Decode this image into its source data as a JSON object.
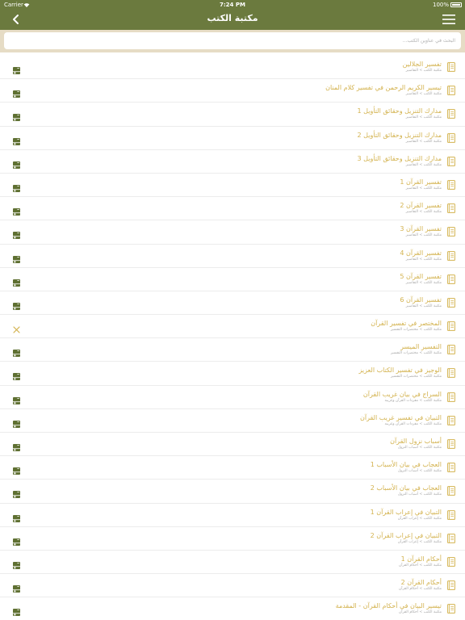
{
  "status_bar": {
    "carrier": "Carrier",
    "time": "7:24 PM",
    "battery": "100%"
  },
  "nav": {
    "title": "مكتبة الكتب"
  },
  "search": {
    "placeholder": "البحث في عناوين الكتب..."
  },
  "colors": {
    "header": "#6b7a3e",
    "search_bg": "#e6dcc5",
    "title_text": "#d3b24e",
    "subtitle_text": "#a8a8a8",
    "download_icon": "#5f7032",
    "book_icon": "#d3b24e"
  },
  "books": [
    {
      "title": "تفسير الجلالين",
      "subtitle": "مكتبة الكتب > التفاسير",
      "action": "download-icon"
    },
    {
      "title": "تيسير الكريم الرحمن في تفسير كلام المنان",
      "subtitle": "مكتبة الكتب > التفاسير",
      "action": "download-icon"
    },
    {
      "title": "مدارك التنزيل وحقائق التأويل 1",
      "subtitle": "مكتبة الكتب > التفاسير",
      "action": "download-icon"
    },
    {
      "title": "مدارك التنزيل وحقائق التأويل 2",
      "subtitle": "مكتبة الكتب > التفاسير",
      "action": "download-icon"
    },
    {
      "title": "مدارك التنزيل وحقائق التأويل 3",
      "subtitle": "مكتبة الكتب > التفاسير",
      "action": "download-icon"
    },
    {
      "title": "تفسير القرآن 1",
      "subtitle": "مكتبة الكتب > التفاسير",
      "action": "download-icon"
    },
    {
      "title": "تفسير القرآن 2",
      "subtitle": "مكتبة الكتب > التفاسير",
      "action": "download-icon"
    },
    {
      "title": "تفسير القرآن 3",
      "subtitle": "مكتبة الكتب > التفاسير",
      "action": "download-icon"
    },
    {
      "title": "تفسير القرآن 4",
      "subtitle": "مكتبة الكتب > التفاسير",
      "action": "download-icon"
    },
    {
      "title": "تفسير القرآن 5",
      "subtitle": "مكتبة الكتب > التفاسير",
      "action": "download-icon"
    },
    {
      "title": "تفسير القرآن 6",
      "subtitle": "مكتبة الكتب > التفاسير",
      "action": "download-icon"
    },
    {
      "title": "المختصر في تفسير القرآن",
      "subtitle": "مكتبة الكتب > مختصرات التفسير",
      "action": "close-icon"
    },
    {
      "title": "التفسير الميسر",
      "subtitle": "مكتبة الكتب > مختصرات التفسير",
      "action": "download-icon"
    },
    {
      "title": "الوجيز في تفسير الكتاب العزيز",
      "subtitle": "مكتبة الكتب > مختصرات التفسير",
      "action": "download-icon"
    },
    {
      "title": "السراج في بيان غريب القرآن",
      "subtitle": "مكتبة الكتب > مفردات القرآن وغريبه",
      "action": "download-icon"
    },
    {
      "title": "التبيان في تفسير غريب القرآن",
      "subtitle": "مكتبة الكتب > مفردات القرآن وغريبه",
      "action": "download-icon"
    },
    {
      "title": "أسباب نزول القرآن",
      "subtitle": "مكتبة الكتب > أسباب النزول",
      "action": "download-icon"
    },
    {
      "title": "العجاب في بيان الأسباب 1",
      "subtitle": "مكتبة الكتب > أسباب النزول",
      "action": "download-icon"
    },
    {
      "title": "العجاب في بيان الأسباب 2",
      "subtitle": "مكتبة الكتب > أسباب النزول",
      "action": "download-icon"
    },
    {
      "title": "التبيان في إعراب القرآن 1",
      "subtitle": "مكتبة الكتب > إعراب القرآن",
      "action": "download-icon"
    },
    {
      "title": "التبيان في إعراب القرآن 2",
      "subtitle": "مكتبة الكتب > إعراب القرآن",
      "action": "download-icon"
    },
    {
      "title": "أحكام القرآن 1",
      "subtitle": "مكتبة الكتب > أحكام القرآن",
      "action": "download-icon"
    },
    {
      "title": "أحكام القرآن 2",
      "subtitle": "مكتبة الكتب > أحكام القرآن",
      "action": "download-icon"
    },
    {
      "title": "تيسير البيان في أحكام القرآن - المقدمة",
      "subtitle": "مكتبة الكتب > أحكام القرآن",
      "action": "download-icon"
    }
  ]
}
